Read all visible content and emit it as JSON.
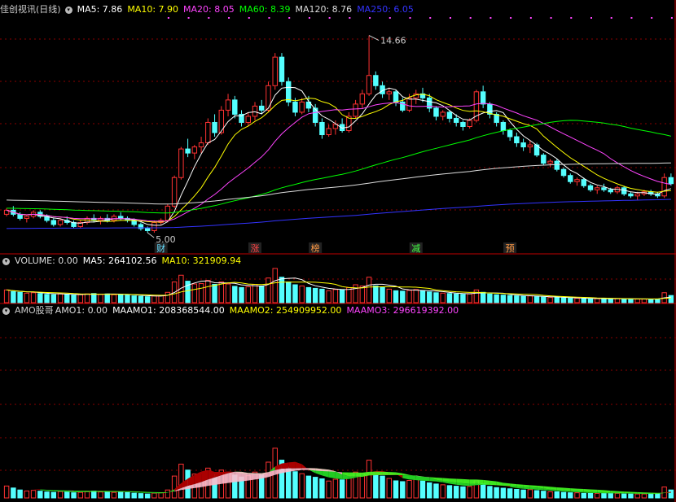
{
  "price_panel": {
    "title": "佳创视讯(日线)",
    "ma_labels": [
      {
        "text": "MA5: 7.86",
        "color": "#ffffff"
      },
      {
        "text": "MA10: 7.90",
        "color": "#ffff00"
      },
      {
        "text": "MA20: 8.05",
        "color": "#ff44ff"
      },
      {
        "text": "MA60: 8.39",
        "color": "#00ff00"
      },
      {
        "text": "MA120: 8.76",
        "color": "#dddddd"
      },
      {
        "text": "MA250: 6.05",
        "color": "#3333ff"
      }
    ],
    "high_label": "14.66",
    "low_label": "5.00",
    "markers": [
      {
        "text": "财",
        "color": "#66ddff"
      },
      {
        "text": "涨",
        "color": "#ff4444"
      },
      {
        "text": "榜",
        "color": "#ff9944"
      },
      {
        "text": "减",
        "color": "#44ff44"
      },
      {
        "text": "预",
        "color": "#ff9944"
      }
    ]
  },
  "volume_panel": {
    "labels": [
      {
        "text": "VOLUME: 0.00",
        "color": "#dddddd"
      },
      {
        "text": "MA5: 264102.56",
        "color": "#ffffff"
      },
      {
        "text": "MA10: 321909.94",
        "color": "#ffff00"
      }
    ]
  },
  "amo_panel": {
    "title": "AMO股哥",
    "labels": [
      {
        "text": "AMO1: 0.00",
        "color": "#dddddd"
      },
      {
        "text": "MAAMO1: 208368544.00",
        "color": "#ffffff"
      },
      {
        "text": "MAAMO2: 254909952.00",
        "color": "#ffff00"
      },
      {
        "text": "MAAMO3: 296619392.00",
        "color": "#ff44ff"
      }
    ]
  },
  "colors": {
    "up": "#ff3232",
    "down": "#54ffff",
    "grid": "#8b0000",
    "border": "#c00000"
  },
  "chart_data": [
    {
      "type": "candlestick",
      "title": "佳创视讯(日线)",
      "ylim": [
        4.6,
        15.6
      ],
      "candles": [
        [
          5.9,
          6.2,
          5.8,
          6.1
        ],
        [
          6.1,
          6.3,
          5.8,
          5.9
        ],
        [
          5.9,
          6.0,
          5.6,
          5.7
        ],
        [
          5.7,
          5.9,
          5.5,
          5.8
        ],
        [
          5.8,
          6.1,
          5.7,
          6.0
        ],
        [
          6.0,
          6.1,
          5.7,
          5.8
        ],
        [
          5.8,
          5.9,
          5.5,
          5.6
        ],
        [
          5.6,
          5.7,
          5.3,
          5.4
        ],
        [
          5.4,
          5.7,
          5.3,
          5.6
        ],
        [
          5.6,
          5.8,
          5.4,
          5.5
        ],
        [
          5.5,
          5.6,
          5.2,
          5.3
        ],
        [
          5.3,
          5.6,
          5.2,
          5.5
        ],
        [
          5.5,
          5.8,
          5.4,
          5.7
        ],
        [
          5.7,
          5.9,
          5.5,
          5.6
        ],
        [
          5.6,
          5.8,
          5.4,
          5.7
        ],
        [
          5.7,
          5.9,
          5.5,
          5.6
        ],
        [
          5.6,
          5.9,
          5.5,
          5.8
        ],
        [
          5.8,
          6.0,
          5.6,
          5.7
        ],
        [
          5.7,
          5.8,
          5.5,
          5.6
        ],
        [
          5.6,
          5.7,
          5.3,
          5.4
        ],
        [
          5.4,
          5.5,
          5.1,
          5.2
        ],
        [
          5.2,
          5.3,
          5.0,
          5.1
        ],
        [
          5.1,
          5.6,
          5.0,
          5.5
        ],
        [
          5.5,
          5.7,
          5.4,
          5.6
        ],
        [
          5.6,
          6.4,
          5.5,
          6.3
        ],
        [
          6.3,
          7.8,
          6.2,
          7.7
        ],
        [
          7.7,
          9.2,
          7.6,
          9.1
        ],
        [
          9.1,
          9.6,
          8.7,
          8.9
        ],
        [
          8.9,
          9.3,
          8.6,
          9.2
        ],
        [
          9.2,
          9.7,
          8.9,
          9.4
        ],
        [
          9.4,
          10.6,
          9.3,
          10.4
        ],
        [
          10.4,
          10.8,
          9.7,
          9.9
        ],
        [
          9.9,
          11.2,
          9.8,
          11.0
        ],
        [
          11.0,
          11.8,
          10.7,
          11.5
        ],
        [
          11.5,
          11.7,
          10.6,
          10.8
        ],
        [
          10.8,
          11.0,
          10.2,
          10.4
        ],
        [
          10.4,
          10.9,
          10.2,
          10.7
        ],
        [
          10.7,
          11.4,
          10.5,
          11.2
        ],
        [
          11.2,
          11.5,
          10.8,
          11.0
        ],
        [
          11.0,
          12.4,
          10.9,
          12.2
        ],
        [
          12.2,
          13.8,
          12.0,
          13.6
        ],
        [
          13.6,
          13.8,
          12.2,
          12.4
        ],
        [
          12.4,
          12.6,
          11.2,
          11.4
        ],
        [
          11.4,
          11.6,
          10.7,
          10.9
        ],
        [
          10.9,
          11.6,
          10.8,
          11.4
        ],
        [
          11.4,
          11.7,
          10.9,
          11.1
        ],
        [
          11.1,
          11.3,
          10.2,
          10.4
        ],
        [
          10.4,
          10.6,
          9.6,
          9.8
        ],
        [
          9.8,
          10.3,
          9.7,
          10.1
        ],
        [
          10.1,
          10.5,
          9.8,
          10.3
        ],
        [
          10.3,
          10.6,
          9.9,
          10.0
        ],
        [
          10.0,
          10.9,
          9.9,
          10.7
        ],
        [
          10.7,
          11.5,
          10.6,
          11.3
        ],
        [
          11.3,
          12.0,
          11.1,
          11.8
        ],
        [
          11.8,
          14.66,
          11.7,
          12.7
        ],
        [
          12.7,
          12.9,
          12.0,
          12.2
        ],
        [
          12.2,
          12.4,
          11.6,
          11.8
        ],
        [
          11.8,
          12.1,
          11.5,
          11.9
        ],
        [
          11.9,
          12.0,
          11.2,
          11.4
        ],
        [
          11.4,
          11.6,
          10.9,
          11.0
        ],
        [
          11.0,
          11.8,
          10.9,
          11.6
        ],
        [
          11.6,
          12.0,
          11.3,
          11.8
        ],
        [
          11.8,
          12.1,
          11.4,
          11.6
        ],
        [
          11.6,
          11.8,
          10.9,
          11.1
        ],
        [
          11.1,
          11.2,
          10.5,
          10.7
        ],
        [
          10.7,
          11.0,
          10.5,
          10.9
        ],
        [
          10.9,
          11.0,
          10.4,
          10.6
        ],
        [
          10.6,
          10.8,
          10.2,
          10.4
        ],
        [
          10.4,
          10.5,
          10.0,
          10.2
        ],
        [
          10.2,
          10.6,
          10.1,
          10.5
        ],
        [
          10.5,
          12.0,
          10.4,
          11.9
        ],
        [
          11.9,
          12.2,
          11.1,
          11.3
        ],
        [
          11.3,
          11.4,
          10.6,
          10.8
        ],
        [
          10.8,
          10.9,
          10.2,
          10.4
        ],
        [
          10.4,
          10.5,
          9.8,
          10.0
        ],
        [
          10.0,
          10.1,
          9.5,
          9.7
        ],
        [
          9.7,
          9.9,
          9.2,
          9.4
        ],
        [
          9.4,
          9.6,
          9.0,
          9.2
        ],
        [
          9.2,
          9.5,
          8.9,
          9.3
        ],
        [
          9.3,
          9.4,
          8.7,
          8.8
        ],
        [
          8.8,
          8.9,
          8.3,
          8.4
        ],
        [
          8.4,
          8.6,
          8.2,
          8.5
        ],
        [
          8.5,
          8.6,
          8.0,
          8.1
        ],
        [
          8.1,
          8.2,
          7.7,
          7.8
        ],
        [
          7.8,
          7.9,
          7.4,
          7.5
        ],
        [
          7.5,
          7.7,
          7.3,
          7.6
        ],
        [
          7.6,
          7.7,
          7.2,
          7.3
        ],
        [
          7.3,
          7.4,
          7.0,
          7.1
        ],
        [
          7.1,
          7.3,
          6.9,
          7.2
        ],
        [
          7.2,
          7.4,
          7.0,
          7.1
        ],
        [
          7.1,
          7.2,
          6.9,
          7.0
        ],
        [
          7.0,
          7.3,
          6.9,
          7.2
        ],
        [
          7.2,
          7.3,
          6.8,
          6.9
        ],
        [
          6.9,
          7.0,
          6.7,
          6.8
        ],
        [
          6.8,
          7.0,
          6.6,
          6.9
        ],
        [
          6.9,
          7.1,
          6.8,
          7.0
        ],
        [
          7.0,
          7.1,
          6.8,
          6.9
        ],
        [
          6.9,
          7.0,
          6.7,
          6.8
        ],
        [
          6.8,
          7.9,
          6.7,
          7.7
        ],
        [
          7.7,
          7.9,
          7.3,
          7.4
        ]
      ],
      "series": [
        {
          "name": "MA5",
          "color": "#ffffff"
        },
        {
          "name": "MA10",
          "color": "#ffff00"
        },
        {
          "name": "MA20",
          "color": "#ff44ff"
        },
        {
          "name": "MA60",
          "color": "#00ff00"
        },
        {
          "name": "MA120",
          "color": "#dddddd"
        },
        {
          "name": "MA250",
          "color": "#3333ff"
        }
      ]
    },
    {
      "type": "bar",
      "title": "VOLUME",
      "ylim": [
        0,
        900000
      ],
      "values": [
        320000,
        280000,
        260000,
        240000,
        250000,
        230000,
        210000,
        200000,
        220000,
        210000,
        190000,
        200000,
        220000,
        230000,
        210000,
        220000,
        200000,
        210000,
        190000,
        170000,
        160000,
        150000,
        170000,
        180000,
        260000,
        520000,
        690000,
        540000,
        470000,
        480000,
        560000,
        460000,
        520000,
        470000,
        410000,
        380000,
        400000,
        460000,
        420000,
        620000,
        860000,
        640000,
        520000,
        450000,
        420000,
        380000,
        360000,
        340000,
        300000,
        330000,
        320000,
        380000,
        450000,
        420000,
        640000,
        420000,
        380000,
        340000,
        300000,
        290000,
        310000,
        330000,
        300000,
        270000,
        250000,
        240000,
        230000,
        220000,
        210000,
        220000,
        320000,
        260000,
        220000,
        200000,
        190000,
        180000,
        170000,
        160000,
        170000,
        150000,
        140000,
        130000,
        130000,
        120000,
        110000,
        110000,
        100000,
        100000,
        100000,
        100000,
        100000,
        100000,
        90000,
        90000,
        90000,
        90000,
        90000,
        90000,
        250000,
        180000
      ]
    },
    {
      "type": "bar",
      "title": "AMO股哥",
      "ylim": [
        0,
        900000000
      ],
      "values": [
        60000000,
        50000000,
        40000000,
        35000000,
        38000000,
        34000000,
        30000000,
        28000000,
        32000000,
        30000000,
        26000000,
        28000000,
        32000000,
        34000000,
        30000000,
        32000000,
        28000000,
        30000000,
        27000000,
        24000000,
        22000000,
        20000000,
        24000000,
        26000000,
        40000000,
        110000000,
        170000000,
        140000000,
        120000000,
        125000000,
        150000000,
        120000000,
        140000000,
        130000000,
        115000000,
        105000000,
        112000000,
        130000000,
        118000000,
        180000000,
        250000000,
        190000000,
        155000000,
        132000000,
        122000000,
        110000000,
        104000000,
        96000000,
        85000000,
        94000000,
        91000000,
        110000000,
        130000000,
        122000000,
        190000000,
        123000000,
        110000000,
        98000000,
        86000000,
        82000000,
        88000000,
        94000000,
        85000000,
        76000000,
        70000000,
        66000000,
        62000000,
        59000000,
        56000000,
        58000000,
        86000000,
        70000000,
        58000000,
        52000000,
        49000000,
        46000000,
        43000000,
        40000000,
        42000000,
        37000000,
        34000000,
        31000000,
        31000000,
        28000000,
        26000000,
        26000000,
        23000000,
        23000000,
        23000000,
        23000000,
        23000000,
        23000000,
        20000000,
        20000000,
        20000000,
        20000000,
        20000000,
        20000000,
        55000000,
        40000000
      ],
      "series": [
        {
          "name": "MAAMO1",
          "color": "#ffffff"
        },
        {
          "name": "MAAMO2",
          "color": "#ffff00"
        },
        {
          "name": "MAAMO3",
          "color": "#ff44ff"
        }
      ]
    }
  ]
}
